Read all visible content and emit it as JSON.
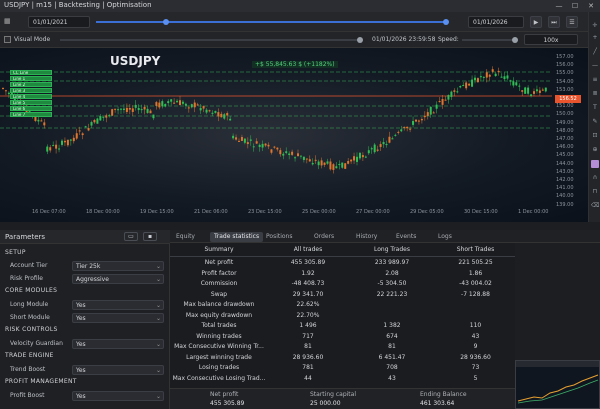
{
  "title": "USDJPY | m15 | Backtesting | Optimisation",
  "toolbar": {
    "start_date": "01/01/2021",
    "end_date": "01/01/2026",
    "play_label": "▶",
    "step_label": "⏭",
    "menu_label": "☰"
  },
  "toolbar2": {
    "visual_mode_label": "Visual Mode",
    "current_time": "01/01/2026 23:59:58",
    "speed_label": "Speed:",
    "speed_value": "100x"
  },
  "chart": {
    "symbol": "USDJPY",
    "badge": "+$ 55,845.63 $ (+1182%)",
    "price_labels": [
      "157.00",
      "156.00",
      "155.00",
      "154.00",
      "153.00",
      "152.00",
      "151.00",
      "150.00",
      "149.00",
      "148.00",
      "147.00",
      "146.00",
      "145.00",
      "144.00",
      "143.00",
      "142.00",
      "141.00",
      "140.00",
      "139.00"
    ],
    "current_price": "156.52",
    "date_labels": [
      "16 Dec 07:00",
      "18 Dec 00:00",
      "19 Dec 15:00",
      "21 Dec 06:00",
      "23 Dec 15:00",
      "25 Dec 00:00",
      "27 Dec 00:00",
      "29 Dec 05:00",
      "30 Dec 15:00",
      "1 Dec 00:00"
    ],
    "order_labels": [
      "CC Line",
      "Line 1",
      "Line 2",
      "Line 3",
      "Line 4",
      "Line 5",
      "Line 6",
      "Line 7"
    ]
  },
  "params": {
    "title": "Parameters",
    "groups": [
      {
        "name": "SETUP"
      },
      {
        "name": "CORE MODULES"
      },
      {
        "name": "RISK CONTROLS"
      },
      {
        "name": "TRADE ENGINE"
      },
      {
        "name": "PROFIT MANAGEMENT"
      }
    ],
    "rows": [
      {
        "label": "Account Tier",
        "value": "Tier 25k"
      },
      {
        "label": "Risk Profile",
        "value": "Aggressive"
      },
      {
        "label": "Long Module",
        "value": "Yes"
      },
      {
        "label": "Short Module",
        "value": "Yes"
      },
      {
        "label": "Velocity Guardian",
        "value": "Yes"
      },
      {
        "label": "Trend Boost",
        "value": "Yes"
      },
      {
        "label": "Profit Boost",
        "value": "Yes"
      }
    ]
  },
  "tabs": [
    "Equity",
    "Trade statistics",
    "Positions",
    "Orders",
    "History",
    "Events",
    "Logs"
  ],
  "stats": {
    "headers": [
      "Summary",
      "All trades",
      "Long Trades",
      "Short Trades"
    ],
    "rows": [
      [
        "Net profit",
        "455 305.89",
        "233 989.97",
        "221 505.25"
      ],
      [
        "Profit factor",
        "1.92",
        "2.08",
        "1.86"
      ],
      [
        "Commission",
        "-48 408.73",
        "-5 304.50",
        "-43 004.02"
      ],
      [
        "Swap",
        "29 341.70",
        "22 221.23",
        "-7 128.88"
      ],
      [
        "Max balance drawdown",
        "22.62%",
        "",
        ""
      ],
      [
        "Max equity drawdown",
        "22.70%",
        "",
        ""
      ],
      [
        "Total trades",
        "1 496",
        "1 382",
        "110"
      ],
      [
        "Winning trades",
        "717",
        "674",
        "43"
      ],
      [
        "Max Consecutive Winning Tr...",
        "81",
        "81",
        "9"
      ],
      [
        "Largest winning trade",
        "28 936.60",
        "6 451.47",
        "28 936.60"
      ],
      [
        "Losing trades",
        "781",
        "708",
        "73"
      ],
      [
        "Max Consecutive Losing Trad...",
        "44",
        "43",
        "5"
      ]
    ]
  },
  "summary": {
    "labels": [
      "Net profit",
      "Starting capital",
      "Ending Balance"
    ],
    "values": [
      "455 305.89",
      "25 000.00",
      "461 303.64"
    ]
  }
}
